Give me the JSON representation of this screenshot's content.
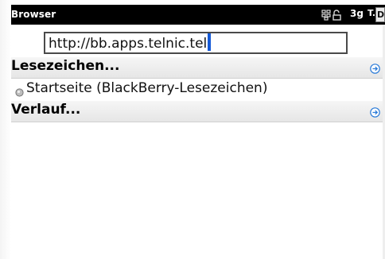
{
  "status_bar": {
    "app_title": "Browser",
    "network": "3g",
    "signal": "T.ıl",
    "truncated_label": "DI"
  },
  "address_bar": {
    "url": "http://bb.apps.telnic.tel"
  },
  "sections": {
    "bookmarks_title": "Lesezeichen...",
    "bookmark_item": "Startseite (BlackBerry-Lesezeichen)",
    "history_title": "Verlauf..."
  },
  "colors": {
    "accent": "#1459d6",
    "status_bar_bg": "#000000"
  },
  "icons": [
    "blackberry-icon",
    "lock-icon",
    "expand-arrow-icon",
    "bullet-icon"
  ]
}
